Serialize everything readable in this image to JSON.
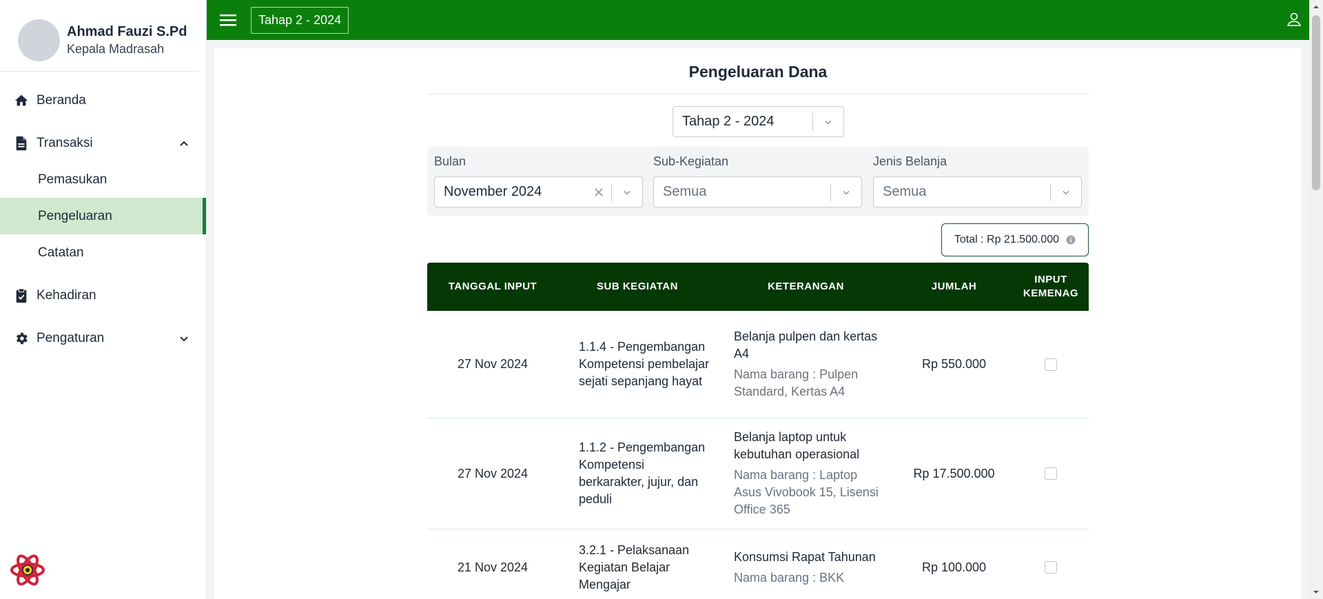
{
  "sidebar": {
    "user_name": "Ahmad Fauzi S.Pd",
    "user_role": "Kepala Madrasah",
    "nav": {
      "beranda": "Beranda",
      "transaksi": "Transaksi",
      "pemasukan": "Pemasukan",
      "pengeluaran": "Pengeluaran",
      "catatan": "Catatan",
      "kehadiran": "Kehadiran",
      "pengaturan": "Pengaturan"
    }
  },
  "topbar": {
    "period": "Tahap 2 - 2024"
  },
  "main": {
    "title": "Pengeluaran Dana",
    "period_select": "Tahap 2 - 2024",
    "filters": {
      "bulan_label": "Bulan",
      "bulan_value": "November 2024",
      "subkegiatan_label": "Sub-Kegiatan",
      "subkegiatan_value": "Semua",
      "jenis_label": "Jenis Belanja",
      "jenis_value": "Semua"
    },
    "total": "Total : Rp 21.500.000",
    "table": {
      "headers": {
        "tanggal": "TANGGAL INPUT",
        "sub": "SUB KEGIATAN",
        "ket": "KETERANGAN",
        "jumlah": "JUMLAH",
        "input1": "INPUT",
        "input2": "KEMENAG"
      },
      "rows": [
        {
          "tanggal": "27 Nov 2024",
          "sub": "1.1.4 - Pengembangan Kompetensi pembelajar sejati sepanjang hayat",
          "ket": "Belanja pulpen dan kertas A4",
          "barang": "Nama barang : Pulpen Standard, Kertas A4",
          "jumlah": "Rp 550.000"
        },
        {
          "tanggal": "27 Nov 2024",
          "sub": "1.1.2 - Pengembangan Kompetensi berkarakter, jujur, dan peduli",
          "ket": "Belanja laptop untuk kebutuhan operasional",
          "barang": "Nama barang : Laptop Asus Vivobook 15, Lisensi Office 365",
          "jumlah": "Rp 17.500.000"
        },
        {
          "tanggal": "21 Nov 2024",
          "sub": "3.2.1 - Pelaksanaan Kegiatan Belajar Mengajar",
          "ket": "Konsumsi Rapat Tahunan",
          "barang": "Nama barang : BKK",
          "jumlah": "Rp 100.000"
        }
      ]
    }
  },
  "colors": {
    "topbar": "#0b7f0b",
    "table_header": "#053805",
    "active_nav_bg": "#cfeacf",
    "active_nav_border": "#15803d"
  }
}
